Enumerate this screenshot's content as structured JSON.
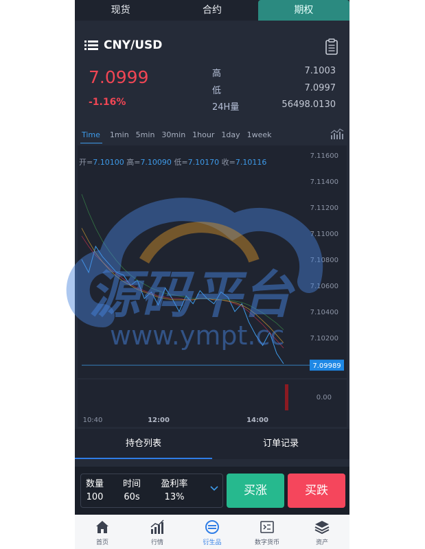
{
  "top_tabs": [
    "现货",
    "合约",
    "期权"
  ],
  "pair": "CNY/USD",
  "price": "7.0999",
  "change": "-1.16%",
  "stats": [
    {
      "label": "高",
      "value": "7.1003"
    },
    {
      "label": "低",
      "value": "7.0997"
    },
    {
      "label": "24H量",
      "value": "56498.0130"
    }
  ],
  "timeframes": [
    "Time",
    "1min",
    "5min",
    "30min",
    "1hour",
    "1day",
    "1week"
  ],
  "ohlc": {
    "open_label": "开=",
    "open": "7.10100",
    "high_label": "高=",
    "high": "7.10090",
    "low_label": "低=",
    "low": "7.10170",
    "close_label": "收=",
    "close": "7.10116"
  },
  "chart_data": {
    "type": "line",
    "y_ticks": [
      "7.11600",
      "7.11400",
      "7.11200",
      "7.11000",
      "7.10800",
      "7.10600",
      "7.10400",
      "7.10200"
    ],
    "ylim": [
      7.1,
      7.116
    ],
    "x_ticks": [
      "10:40",
      "12:00",
      "14:00"
    ],
    "current_price_label": "7.09989",
    "current_price": 7.09989,
    "volume_axis_label": "0.00",
    "series": [
      {
        "color": "#3e9bea",
        "values": [
          7.108,
          7.107,
          7.109,
          7.1082,
          7.1076,
          7.107,
          7.1068,
          7.106,
          7.1064,
          7.105,
          7.1055,
          7.1045,
          7.1058,
          7.105,
          7.104,
          7.1052,
          7.1046,
          7.1056,
          7.105,
          7.1046,
          7.1055,
          7.1051,
          7.104,
          7.1046,
          7.1032,
          7.1022,
          7.1014,
          7.1024,
          7.1008,
          7.1
        ]
      },
      {
        "color": "#c0314d",
        "values": [
          7.1098,
          7.109,
          7.1083,
          7.1078,
          7.1073,
          7.1069,
          7.1065,
          7.1061,
          7.1058,
          7.1056,
          7.1054,
          7.1052,
          7.1051,
          7.105,
          7.105,
          7.1049,
          7.1049,
          7.105,
          7.105,
          7.1049,
          7.1049,
          7.1048,
          7.1046,
          7.1044,
          7.104,
          7.1035,
          7.103,
          7.1024,
          7.1018,
          7.1012
        ]
      },
      {
        "color": "#d4a030",
        "values": [
          7.1104,
          7.1094,
          7.1085,
          7.1078,
          7.1072,
          7.1067,
          7.1063,
          7.106,
          7.1057,
          7.1055,
          7.1053,
          7.1051,
          7.105,
          7.1049,
          7.1049,
          7.1049,
          7.1049,
          7.105,
          7.105,
          7.1049,
          7.1049,
          7.1048,
          7.1047,
          7.1045,
          7.1042,
          7.1038,
          7.1033,
          7.1028,
          7.1022,
          7.1016
        ]
      },
      {
        "color": "#3a8a4a",
        "values": [
          7.113,
          7.1116,
          7.1104,
          7.1094,
          7.1086,
          7.1079,
          7.1073,
          7.1068,
          7.1064,
          7.1061,
          7.1058,
          7.1056,
          7.1054,
          7.1053,
          7.1052,
          7.1051,
          7.105,
          7.105,
          7.105,
          7.105,
          7.1049,
          7.1049,
          7.1048,
          7.1047,
          7.1045,
          7.1042,
          7.1039,
          7.1035,
          7.1031,
          7.1026
        ]
      }
    ]
  },
  "watermark": {
    "title": "源码平台",
    "url": "www.ympt.cc"
  },
  "position_tabs": [
    "持仓列表",
    "订单记录"
  ],
  "trade_params": [
    {
      "label": "数量",
      "value": "100"
    },
    {
      "label": "时间",
      "value": "60s"
    },
    {
      "label": "盈利率",
      "value": "13%"
    }
  ],
  "buttons": {
    "up": "买涨",
    "down": "买跌"
  },
  "nav": [
    {
      "label": "首页",
      "icon": "home-icon"
    },
    {
      "label": "行情",
      "icon": "market-icon"
    },
    {
      "label": "衍生品",
      "icon": "derivatives-icon"
    },
    {
      "label": "数字货币",
      "icon": "crypto-icon"
    },
    {
      "label": "资产",
      "icon": "assets-icon"
    }
  ],
  "colors": {
    "bg": "#252b38",
    "accent": "#2b8a80",
    "up": "#26b98e",
    "down": "#f5465c",
    "price_down": "#f04654",
    "blue": "#3e9bea"
  }
}
